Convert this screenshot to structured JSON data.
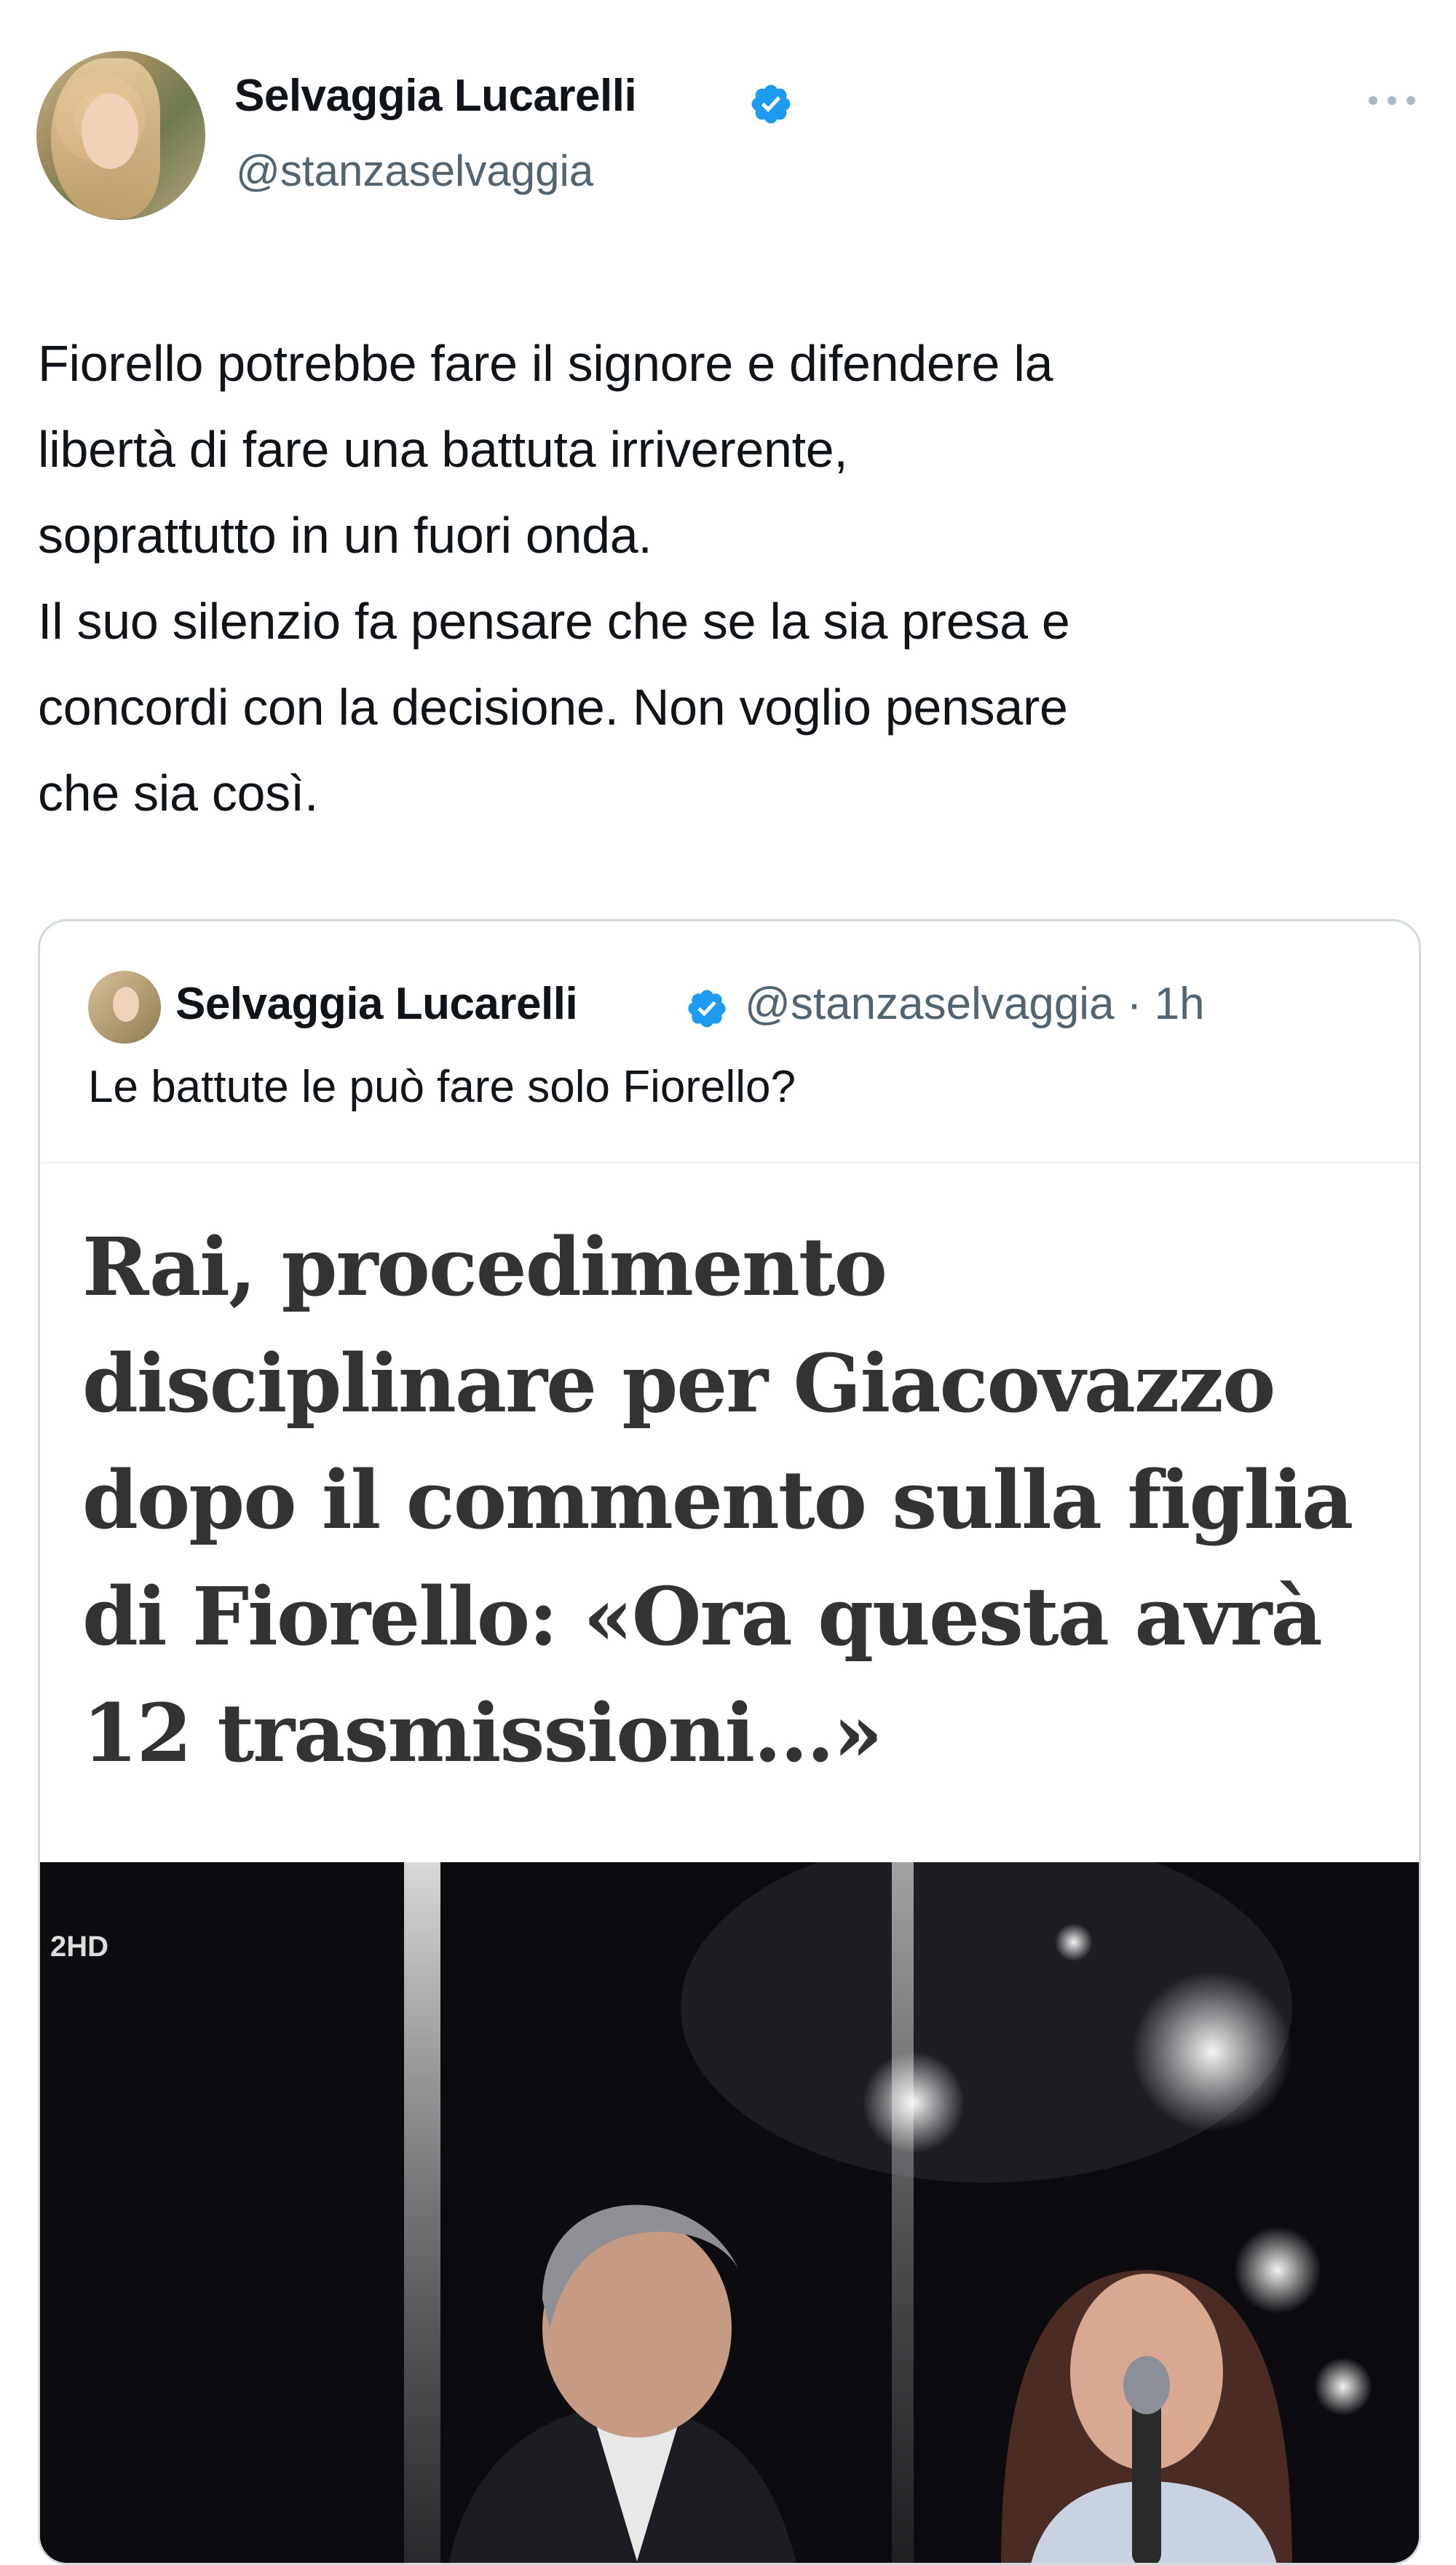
{
  "tweet": {
    "author_name": "Selvaggia Lucarelli",
    "handle": "@stanzaselvaggia",
    "text": "Fiorello potrebbe fare il signore e difendere la\nlibertà di fare una battuta irriverente,\nsoprattutto in un fuori onda.\nIl suo silenzio fa pensare che se la sia presa e\nconcordi con la decisione. Non voglio pensare\nche sia così."
  },
  "quoted_tweet": {
    "author_name": "Selvaggia Lucarelli",
    "meta": "@stanzaselvaggia · 1h",
    "text": "Le battute le può fare solo Fiorello?",
    "headline": "Rai, procedimento\ndisciplinare per Giacovazzo\ndopo il commento sulla figlia\ndi Fiorello: «Ora questa avrà\n12 trasmissioni...»",
    "video_channel_logo": "2HD"
  },
  "icons": {
    "verified": "verified-badge-icon",
    "more": "more-options-icon"
  },
  "colors": {
    "verified_blue": "#1d9bf0",
    "secondary_text": "#536471",
    "border": "#cfd9de",
    "headline_text": "#333333"
  }
}
